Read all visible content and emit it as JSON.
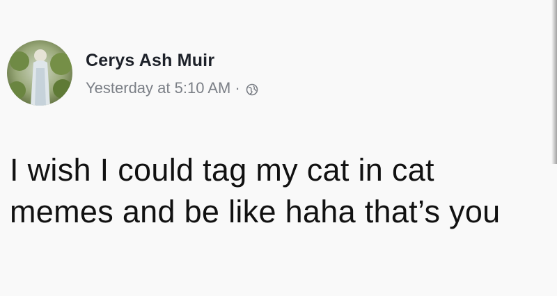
{
  "post": {
    "author": {
      "name": "Cerys Ash Muir",
      "avatar_icon": "profile-photo"
    },
    "timestamp": "Yesterday at 5:10 AM",
    "separator": "·",
    "privacy_icon": "globe-icon",
    "text": "I wish I could tag my cat in cat memes and be like haha that’s you"
  },
  "colors": {
    "background": "#f9f9f9",
    "name": "#1d2129",
    "meta": "#7b7f86",
    "text": "#111111"
  }
}
